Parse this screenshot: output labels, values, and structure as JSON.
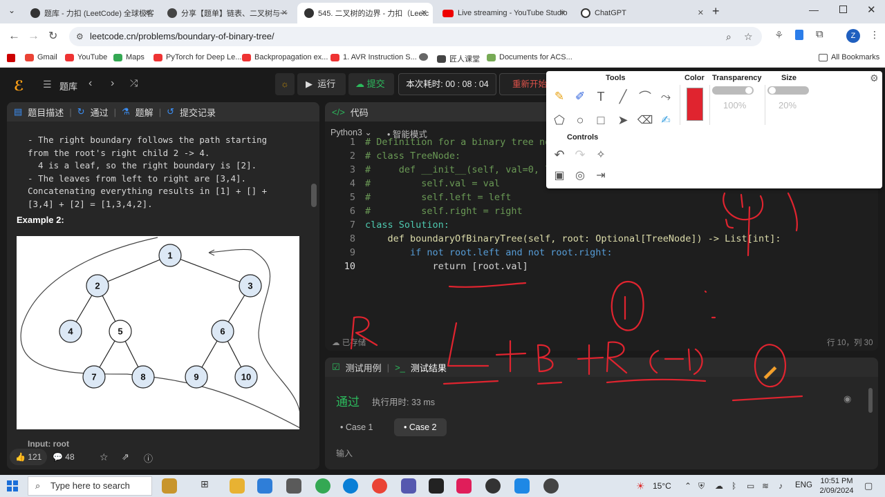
{
  "browser": {
    "tabs": [
      {
        "title": "题库 - 力扣 (LeetCode) 全球极客",
        "active": false,
        "color": "#333"
      },
      {
        "title": "分享【题单】链表、二叉树与一",
        "active": false,
        "color": "#333"
      },
      {
        "title": "545. 二叉树的边界 - 力扣（Leetc",
        "active": true,
        "color": "#333"
      },
      {
        "title": "Live streaming - YouTube Studio",
        "active": false,
        "color": "#e00"
      },
      {
        "title": "ChatGPT",
        "active": false,
        "color": "#333"
      }
    ],
    "url": "leetcode.cn/problems/boundary-of-binary-tree/",
    "profile_letter": "Z",
    "bookmarks": [
      "Gmail",
      "YouTube",
      "Maps",
      "PyTorch for Deep Le...",
      "Backpropagation ex...",
      "1. AVR Instruction S...",
      "匠人课堂",
      "Documents for ACS..."
    ],
    "all_bookmarks": "All Bookmarks"
  },
  "header": {
    "problem_list": "题库",
    "run": "运行",
    "submit": "提交",
    "timer": "本次耗时: 00 : 08 : 04",
    "restart": "重新开始"
  },
  "left_panel": {
    "tabs": [
      "题目描述",
      "通过",
      "题解",
      "提交记录"
    ],
    "description_lines": [
      "- The right boundary follows the path starting",
      "from the root's right child 2 -> 4.",
      "  4 is a leaf, so the right boundary is [2].",
      "- The leaves from left to right are [3,4].",
      "Concatenating everything results in [1] + [] +",
      "[3,4] + [2] = [1,3,4,2]."
    ],
    "example_heading": "Example 2:",
    "input_label": "Input: root",
    "likes": "121",
    "comments": "48",
    "tree_nodes": [
      "1",
      "2",
      "3",
      "4",
      "5",
      "6",
      "7",
      "8",
      "9",
      "10"
    ]
  },
  "editor": {
    "title": "代码",
    "language": "Python3",
    "mode": "智能模式",
    "lines": [
      {
        "n": "1",
        "text": "# Definition for a binary tree node."
      },
      {
        "n": "2",
        "text": "# class TreeNode:"
      },
      {
        "n": "3",
        "text": "#     def __init__(self, val=0, left=None, right=None):"
      },
      {
        "n": "4",
        "text": "#         self.val = val"
      },
      {
        "n": "5",
        "text": "#         self.left = left"
      },
      {
        "n": "6",
        "text": "#         self.right = right"
      },
      {
        "n": "7",
        "text": "class Solution:"
      },
      {
        "n": "8",
        "text": "    def boundaryOfBinaryTree(self, root: Optional[TreeNode]) -> List[int]:"
      },
      {
        "n": "9",
        "text": "        if not root.left and not root.right:"
      },
      {
        "n": "10",
        "text": "            return [root.val]"
      }
    ],
    "saved": "已存储",
    "cursor": "行 10，列 30"
  },
  "results": {
    "tab_testcase": "测试用例",
    "tab_result": "测试结果",
    "status": "通过",
    "runtime": "执行用时: 33 ms",
    "cases": [
      "Case 1",
      "Case 2"
    ],
    "input_label": "输入"
  },
  "annotation_toolbar": {
    "tools_title": "Tools",
    "color_title": "Color",
    "transparency_title": "Transparency",
    "size_title": "Size",
    "controls_title": "Controls",
    "transparency_value": "100%",
    "size_value": "20%",
    "pen_color": "#e0242f"
  },
  "taskbar": {
    "search_placeholder": "Type here to search",
    "temperature": "15°C",
    "language": "ENG",
    "time": "10:51 PM",
    "date": "2/09/2024"
  }
}
